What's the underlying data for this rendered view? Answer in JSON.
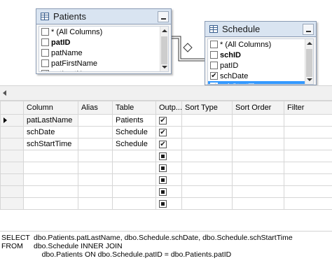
{
  "diagram": {
    "tables": [
      {
        "title": "Patients",
        "columns": [
          {
            "label": "* (All Columns)",
            "checked": false,
            "bold": false,
            "selected": false
          },
          {
            "label": "patID",
            "checked": false,
            "bold": true,
            "selected": false
          },
          {
            "label": "patName",
            "checked": false,
            "bold": false,
            "selected": false
          },
          {
            "label": "patFirstName",
            "checked": false,
            "bold": false,
            "selected": false
          },
          {
            "label": "patLastName",
            "checked": true,
            "bold": false,
            "selected": false
          }
        ]
      },
      {
        "title": "Schedule",
        "columns": [
          {
            "label": "* (All Columns)",
            "checked": false,
            "bold": false,
            "selected": false
          },
          {
            "label": "schID",
            "checked": false,
            "bold": true,
            "selected": false
          },
          {
            "label": "patID",
            "checked": false,
            "bold": false,
            "selected": false
          },
          {
            "label": "schDate",
            "checked": true,
            "bold": false,
            "selected": false
          },
          {
            "label": "schStartTime",
            "checked": true,
            "bold": false,
            "selected": true
          }
        ]
      }
    ]
  },
  "grid": {
    "headers": [
      "Column",
      "Alias",
      "Table",
      "Outp...",
      "Sort Type",
      "Sort Order",
      "Filter"
    ],
    "rows": [
      {
        "column": "patLastName",
        "alias": "",
        "table": "Patients",
        "output": "checked"
      },
      {
        "column": "schDate",
        "alias": "",
        "table": "Schedule",
        "output": "checked"
      },
      {
        "column": "schStartTime",
        "alias": "",
        "table": "Schedule",
        "output": "checked"
      },
      {
        "column": "",
        "alias": "",
        "table": "",
        "output": "empty"
      },
      {
        "column": "",
        "alias": "",
        "table": "",
        "output": "empty"
      },
      {
        "column": "",
        "alias": "",
        "table": "",
        "output": "empty"
      },
      {
        "column": "",
        "alias": "",
        "table": "",
        "output": "empty"
      },
      {
        "column": "",
        "alias": "",
        "table": "",
        "output": "empty"
      }
    ]
  },
  "sql": {
    "lines": [
      {
        "keyword": "SELECT",
        "text": "dbo.Patients.patLastName, dbo.Schedule.schDate, dbo.Schedule.schStartTime"
      },
      {
        "keyword": "FROM",
        "text": "dbo.Schedule INNER JOIN"
      },
      {
        "keyword": "",
        "text": "    dbo.Patients ON dbo.Schedule.patID = dbo.Patients.patID"
      }
    ]
  }
}
